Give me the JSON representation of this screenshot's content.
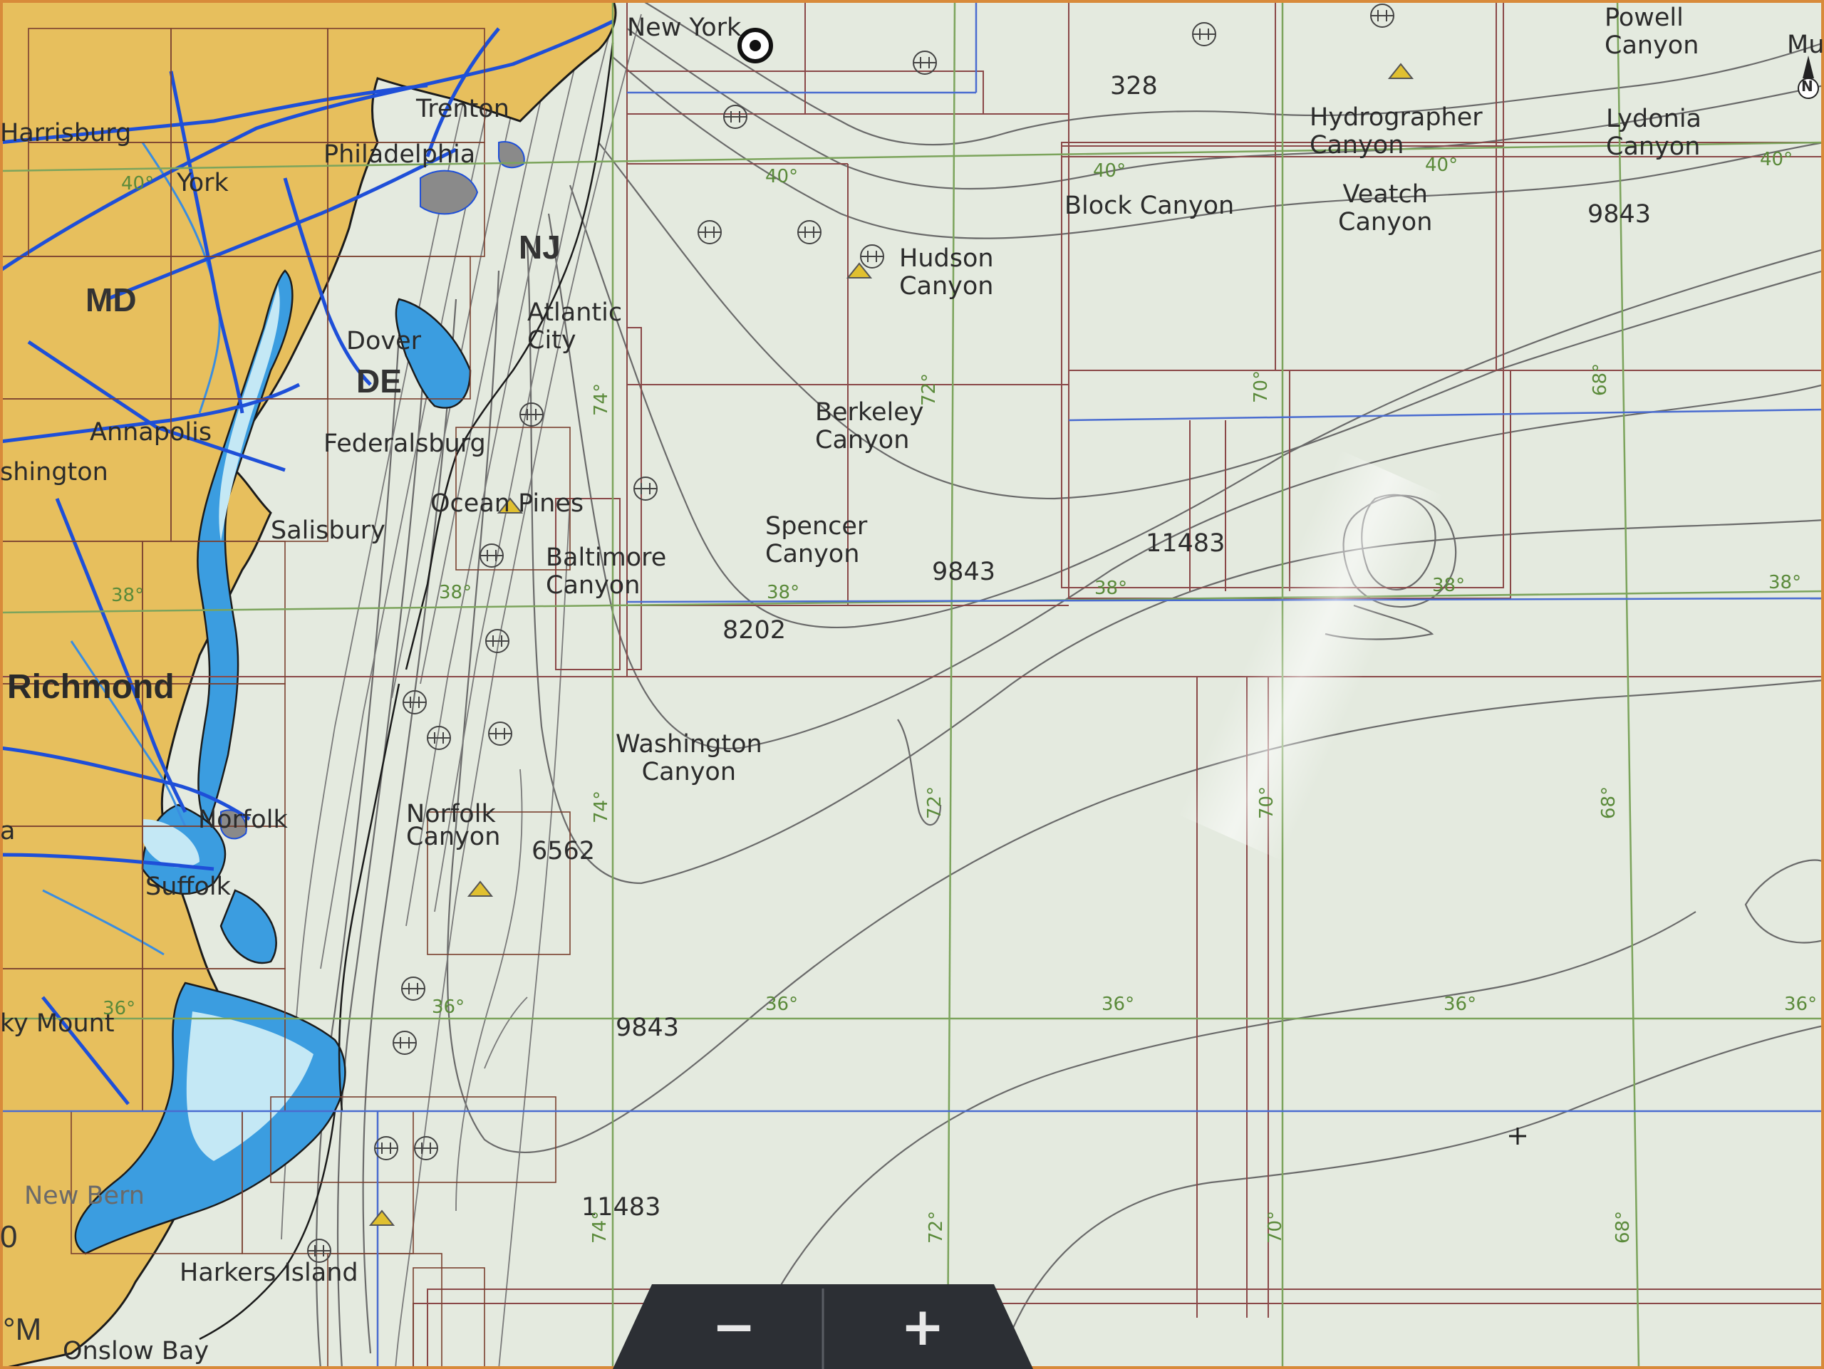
{
  "colors": {
    "land": "#e8c060",
    "water_shallow": "#3fa0e0",
    "water_light": "#bfe6f5",
    "ocean": "#e3e9df",
    "roads": "#1a4fd8",
    "grid_lines": "#7aa060",
    "boundary_lines": "#8a4a4a",
    "contours": "#666666",
    "zoom_panel": "#2c2f34"
  },
  "states": [
    "MD",
    "DE",
    "NJ"
  ],
  "places": [
    {
      "id": "new-york",
      "text": "New York"
    },
    {
      "id": "harrisburg",
      "text": "Harrisburg"
    },
    {
      "id": "trenton",
      "text": "Trenton"
    },
    {
      "id": "philadelphia",
      "text": "Philadelphia"
    },
    {
      "id": "york",
      "text": "York"
    },
    {
      "id": "dover",
      "text": "Dover"
    },
    {
      "id": "atlantic-city",
      "text": "Atlantic\nCity"
    },
    {
      "id": "annapolis",
      "text": "Annapolis"
    },
    {
      "id": "washington",
      "text": "shington"
    },
    {
      "id": "federalsburg",
      "text": "Federalsburg"
    },
    {
      "id": "ocean-pines",
      "text": "Ocean Pines"
    },
    {
      "id": "salisbury",
      "text": "Salisbury"
    },
    {
      "id": "richmond",
      "text": "Richmond"
    },
    {
      "id": "norfolk",
      "text": "Norfolk"
    },
    {
      "id": "suffolk",
      "text": "Suffolk"
    },
    {
      "id": "rocky-mount",
      "text": "ky Mount"
    },
    {
      "id": "new-bern",
      "text": "New Bern"
    },
    {
      "id": "harkers-island",
      "text": "Harkers Island"
    },
    {
      "id": "onslow-bay",
      "text": "Onslow Bay"
    },
    {
      "id": "edge-a",
      "text": "a"
    }
  ],
  "canyons": [
    {
      "id": "powell-canyon",
      "text": "Powell\nCanyon"
    },
    {
      "id": "mu-canyon",
      "text": "Mu"
    },
    {
      "id": "hydrographer-canyon",
      "text": "Hydrographer\nCanyon"
    },
    {
      "id": "lydonia-canyon",
      "text": "Lydonia\nCanyon"
    },
    {
      "id": "veatch-canyon",
      "text": "Veatch\nCanyon"
    },
    {
      "id": "block-canyon",
      "text": "Block Canyon"
    },
    {
      "id": "hudson-canyon",
      "text": "Hudson\nCanyon"
    },
    {
      "id": "berkeley-canyon",
      "text": "Berkeley\nCanyon"
    },
    {
      "id": "spencer-canyon",
      "text": "Spencer\nCanyon"
    },
    {
      "id": "baltimore-canyon",
      "text": "Baltimore\nCanyon"
    },
    {
      "id": "washington-canyon",
      "text": "Washington\nCanyon"
    },
    {
      "id": "norfolk-canyon",
      "text": "Norfolk\nCanyon"
    }
  ],
  "depths": [
    {
      "id": "d-328",
      "text": "328"
    },
    {
      "id": "d-9843-ne",
      "text": "9843"
    },
    {
      "id": "d-11483-mid",
      "text": "11483"
    },
    {
      "id": "d-9843-mid",
      "text": "9843"
    },
    {
      "id": "d-8202",
      "text": "8202"
    },
    {
      "id": "d-6562",
      "text": "6562"
    },
    {
      "id": "d-9843-s",
      "text": "9843"
    },
    {
      "id": "d-11483-s",
      "text": "11483"
    }
  ],
  "grid_labels": [
    {
      "id": "g40-york",
      "text": "40°"
    },
    {
      "id": "g40-hudson",
      "text": "40°"
    },
    {
      "id": "g40-block",
      "text": "40°"
    },
    {
      "id": "g40-hydro",
      "text": "40°"
    },
    {
      "id": "g40-east",
      "text": "40°"
    },
    {
      "id": "g38-west",
      "text": "38°"
    },
    {
      "id": "g38-delmarva",
      "text": "38°"
    },
    {
      "id": "g38-spencer",
      "text": "38°"
    },
    {
      "id": "g38-mid",
      "text": "38°"
    },
    {
      "id": "g38-68",
      "text": "38°"
    },
    {
      "id": "g38-east",
      "text": "38°"
    },
    {
      "id": "g36-west",
      "text": "36°"
    },
    {
      "id": "g36-coast",
      "text": "36°"
    },
    {
      "id": "g36-74",
      "text": "36°"
    },
    {
      "id": "g36-72",
      "text": "36°"
    },
    {
      "id": "g36-70",
      "text": "36°"
    },
    {
      "id": "g36-east",
      "text": "36°"
    },
    {
      "id": "g74-n",
      "text": "74°"
    },
    {
      "id": "g74-mid",
      "text": "74°"
    },
    {
      "id": "g74-s",
      "text": "74°"
    },
    {
      "id": "g72-n",
      "text": "72°"
    },
    {
      "id": "g72-mid",
      "text": "72°"
    },
    {
      "id": "g72-s",
      "text": "72°"
    },
    {
      "id": "g70-n",
      "text": "70°"
    },
    {
      "id": "g70-mid",
      "text": "70°"
    },
    {
      "id": "g70-s",
      "text": "70°"
    },
    {
      "id": "g68-n",
      "text": "68°"
    },
    {
      "id": "g68-mid",
      "text": "68°"
    },
    {
      "id": "g68-s",
      "text": "68°"
    }
  ],
  "scale": {
    "unit": "°M",
    "value": "0"
  },
  "compass": {
    "label": "N"
  },
  "zoom": {
    "out_label": "−",
    "in_label": "+"
  }
}
